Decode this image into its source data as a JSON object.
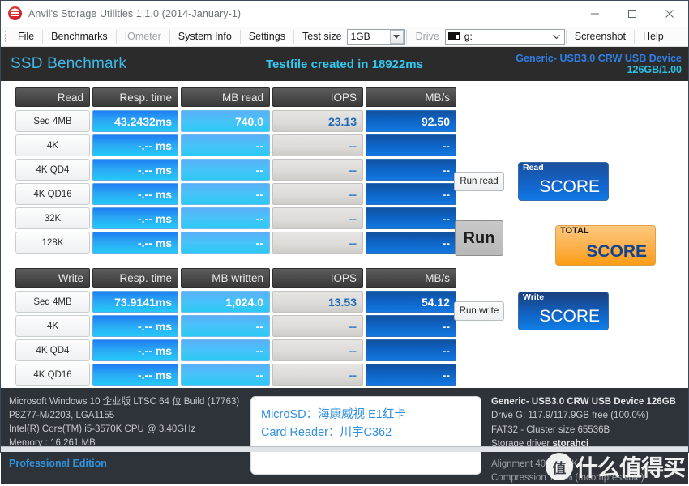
{
  "window": {
    "title": "Anvil's Storage Utilities 1.1.0 (2014-January-1)",
    "icon": "bank-icon",
    "minimize": "—",
    "maximize": "□",
    "close": "✕"
  },
  "menubar": {
    "items": [
      {
        "label": "File",
        "disabled": false
      },
      {
        "label": "Benchmarks",
        "disabled": false
      },
      {
        "label": "IOmeter",
        "disabled": true
      },
      {
        "label": "System Info",
        "disabled": false
      },
      {
        "label": "Settings",
        "disabled": false
      }
    ],
    "test_size_label": "Test size",
    "test_size_value": "1GB",
    "drive_label": "Drive",
    "drive_value": "g:",
    "drive_icon": "drive-icon",
    "screenshot": "Screenshot",
    "help": "Help"
  },
  "header": {
    "title": "SSD Benchmark",
    "message": "Testfile created in 18922ms",
    "device_line1": "Generic- USB3.0 CRW USB Device",
    "device_line2": "126GB/1.00"
  },
  "read_table": {
    "headers": [
      "Read",
      "Resp. time",
      "MB read",
      "IOPS",
      "MB/s"
    ],
    "rows": [
      {
        "label": "Seq 4MB",
        "resp": "43.2432ms",
        "mb": "740.0",
        "iops": "23.13",
        "mbs": "92.50"
      },
      {
        "label": "4K",
        "resp": "-.-- ms",
        "mb": "--",
        "iops": "--",
        "mbs": "--"
      },
      {
        "label": "4K QD4",
        "resp": "-.-- ms",
        "mb": "--",
        "iops": "--",
        "mbs": "--"
      },
      {
        "label": "4K QD16",
        "resp": "-.-- ms",
        "mb": "--",
        "iops": "--",
        "mbs": "--"
      },
      {
        "label": "32K",
        "resp": "-.-- ms",
        "mb": "--",
        "iops": "--",
        "mbs": "--"
      },
      {
        "label": "128K",
        "resp": "-.-- ms",
        "mb": "--",
        "iops": "--",
        "mbs": "--"
      }
    ]
  },
  "write_table": {
    "headers": [
      "Write",
      "Resp. time",
      "MB written",
      "IOPS",
      "MB/s"
    ],
    "rows": [
      {
        "label": "Seq 4MB",
        "resp": "73.9141ms",
        "mb": "1,024.0",
        "iops": "13.53",
        "mbs": "54.12"
      },
      {
        "label": "4K",
        "resp": "-.-- ms",
        "mb": "--",
        "iops": "--",
        "mbs": "--"
      },
      {
        "label": "4K QD4",
        "resp": "-.-- ms",
        "mb": "--",
        "iops": "--",
        "mbs": "--"
      },
      {
        "label": "4K QD16",
        "resp": "-.-- ms",
        "mb": "--",
        "iops": "--",
        "mbs": "--"
      }
    ]
  },
  "controls": {
    "run_read": "Run read",
    "run": "Run",
    "run_write": "Run write",
    "read_score_kicker": "Read",
    "read_score_value": "SCORE",
    "total_score_kicker": "TOTAL",
    "total_score_value": "SCORE",
    "write_score_kicker": "Write",
    "write_score_value": "SCORE"
  },
  "system_info": {
    "os": "Microsoft Windows 10 企业版 LTSC 64 位 Build (17763)",
    "board": "P8Z77-M/2203, LGA1155",
    "cpu": "Intel(R) Core(TM) i5-3570K CPU @ 3.40GHz",
    "memory": "Memory : 16,261 MB",
    "edition": "Professional Edition"
  },
  "note": {
    "line1": "MicroSD：海康威视 E1红卡",
    "line2": "Card Reader：川宇C362"
  },
  "drive_info": {
    "title": "Generic- USB3.0 CRW USB Device 126GB",
    "free": "Drive G: 117.9/117.9GB free (100.0%)",
    "fs": "FAT32 - Cluster size 65536B",
    "driver_label": "Storage driver",
    "driver_value": "storahci",
    "alignment": "Alignment 4096 - OK",
    "compression": "Compression 100% (Incompressible)"
  },
  "watermark": {
    "logo": "值",
    "text": "什么值得买"
  },
  "colors": {
    "accent_cyan": "#33c8f0",
    "accent_blue": "#2f7fe8",
    "header_dark": "#2b2b2b",
    "panel_dark": "#2e3339",
    "total_orange": "#fcb04a"
  }
}
